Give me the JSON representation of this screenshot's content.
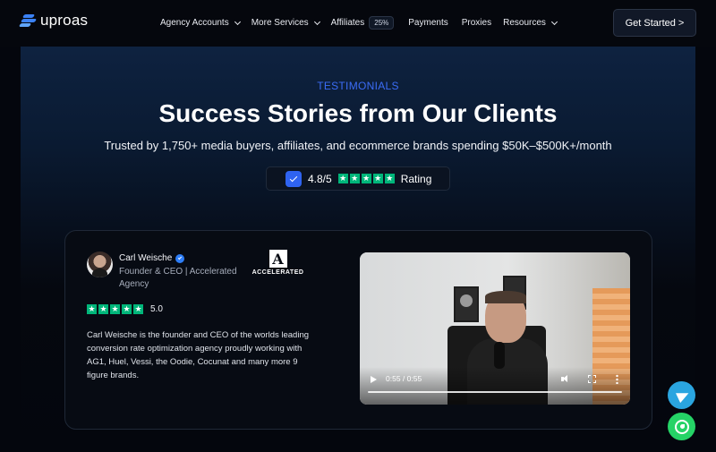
{
  "brand": {
    "logo_text": "uproas"
  },
  "nav": {
    "items": [
      {
        "label": "Agency Accounts",
        "has_dropdown": true
      },
      {
        "label": "More Services",
        "has_dropdown": true
      },
      {
        "label": "Affiliates",
        "badge": "25%"
      },
      {
        "label": "Payments"
      },
      {
        "label": "Proxies"
      },
      {
        "label": "Resources",
        "has_dropdown": true
      }
    ],
    "cta_label": "Get Started >"
  },
  "hero": {
    "eyebrow": "TESTIMONIALS",
    "title": "Success Stories from Our Clients",
    "subtitle": "Trusted by 1,750+ media buyers, affiliates, and ecommerce brands spending $50K–$500K+/month",
    "rating_score": "4.8/5",
    "rating_label": "Rating",
    "rating_stars": 5
  },
  "testimonial": {
    "name": "Carl Weische",
    "role": "Founder & CEO | Accelerated Agency",
    "company_logo_text": "ACCELERATED",
    "stars": 5,
    "score": "5.0",
    "quote": "Carl Weische is the founder and CEO of the worlds leading conversion rate optimization agency proudly working with AG1, Huel, Vessi, the Oodie, Cocunat and many more 9 figure brands.",
    "video": {
      "time": "0:55 / 0:55",
      "progress": 1.0
    }
  },
  "colors": {
    "accent": "#3b6cf6",
    "star_green": "#00b67a",
    "telegram": "#2aa5e0",
    "whatsapp": "#25d366"
  },
  "floating": {
    "icons": [
      "telegram-icon",
      "whatsapp-icon"
    ]
  }
}
